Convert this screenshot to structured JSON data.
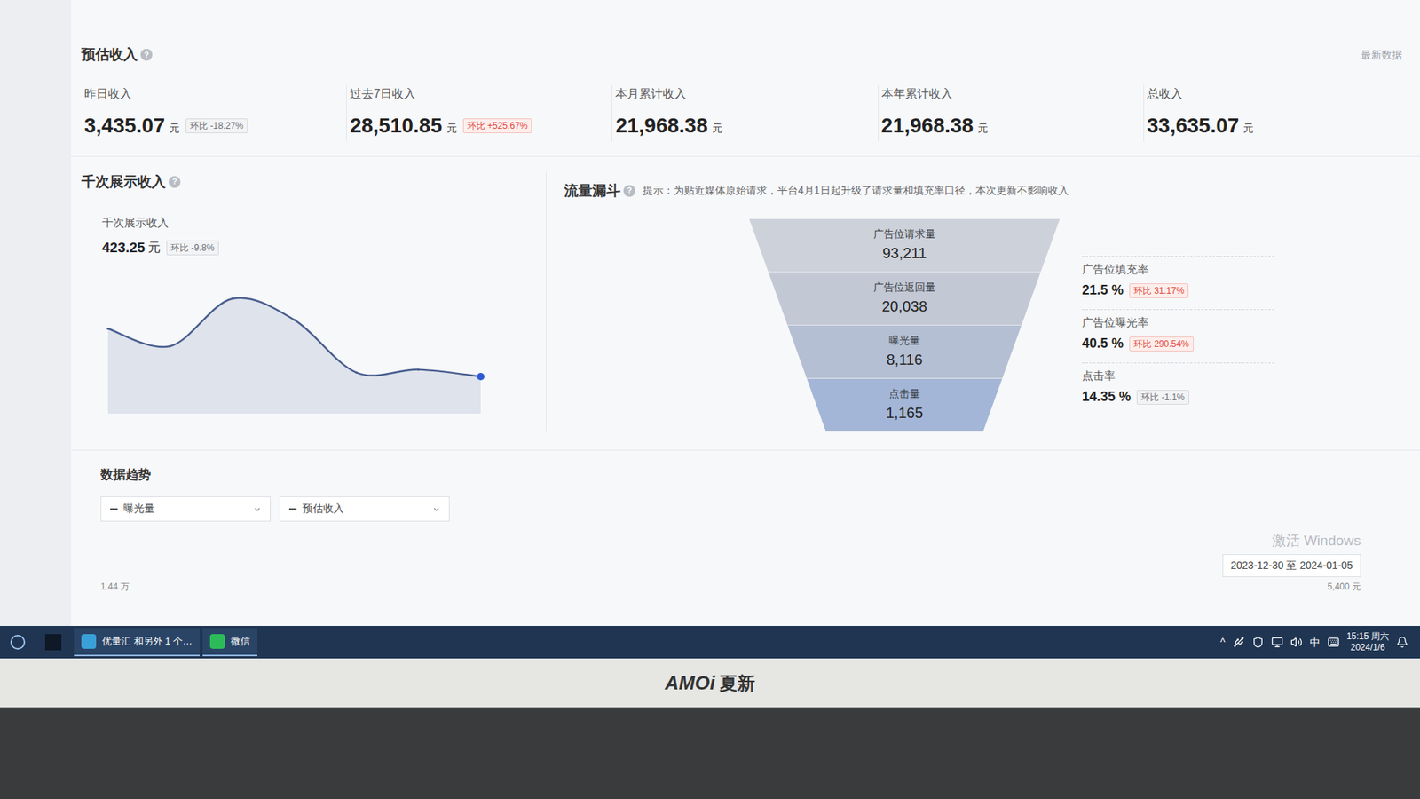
{
  "revenue": {
    "title": "预估收入",
    "help": "?",
    "latest": "最新数据",
    "cards": [
      {
        "label": "昨日收入",
        "value": "3,435.07",
        "unit": "元",
        "change": {
          "label": "环比 -18.27%",
          "up": false
        }
      },
      {
        "label": "过去7日收入",
        "value": "28,510.85",
        "unit": "元",
        "change": {
          "label": "环比 +525.67%",
          "up": true
        }
      },
      {
        "label": "本月累计收入",
        "value": "21,968.38",
        "unit": "元"
      },
      {
        "label": "本年累计收入",
        "value": "21,968.38",
        "unit": "元"
      },
      {
        "label": "总收入",
        "value": "33,635.07",
        "unit": "元"
      }
    ]
  },
  "ecpm": {
    "title": "千次展示收入",
    "help": "?",
    "label": "千次展示收入",
    "value": "423.25",
    "unit": "元",
    "change": {
      "label": "环比 -9.8%",
      "up": false
    },
    "series": [
      505,
      475,
      556,
      520,
      430,
      435,
      423.25
    ]
  },
  "funnel": {
    "title": "流量漏斗",
    "help": "?",
    "tip": "提示：为贴近媒体原始请求，平台4月1日起升级了请求量和填充率口径，本次更新不影响收入",
    "stages": [
      {
        "label": "广告位请求量",
        "value": "93,211"
      },
      {
        "label": "广告位返回量",
        "value": "20,038"
      },
      {
        "label": "曝光量",
        "value": "8,116"
      },
      {
        "label": "点击量",
        "value": "1,165"
      }
    ],
    "rates": [
      {
        "label": "广告位填充率",
        "value": "21.5 %",
        "change": {
          "label": "环比 31.17%",
          "up": true
        }
      },
      {
        "label": "广告位曝光率",
        "value": "40.5 %",
        "change": {
          "label": "环比 290.54%",
          "up": true
        }
      },
      {
        "label": "点击率",
        "value": "14.35 %",
        "change": {
          "label": "环比 -1.1%",
          "up": false
        }
      }
    ]
  },
  "trend": {
    "title": "数据趋势",
    "selects": [
      {
        "label": "曝光量"
      },
      {
        "label": "预估收入"
      }
    ],
    "left_axis": "1.44 万",
    "right_axis": "5,400 元",
    "date_range": "2023-12-30 至 2024-01-05"
  },
  "watermark": {
    "title": "激活 Windows"
  },
  "taskbar": {
    "apps": [
      {
        "label": "优量汇 和另外 1 个…",
        "selected": false
      },
      {
        "label": "微信",
        "selected": false
      }
    ],
    "tray": {
      "chevron": "^",
      "ime": "中",
      "time": "15:15 周六",
      "date": "2024/1/6"
    }
  },
  "bezel": {
    "logo": "AMOi",
    "brand": "夏新"
  }
}
